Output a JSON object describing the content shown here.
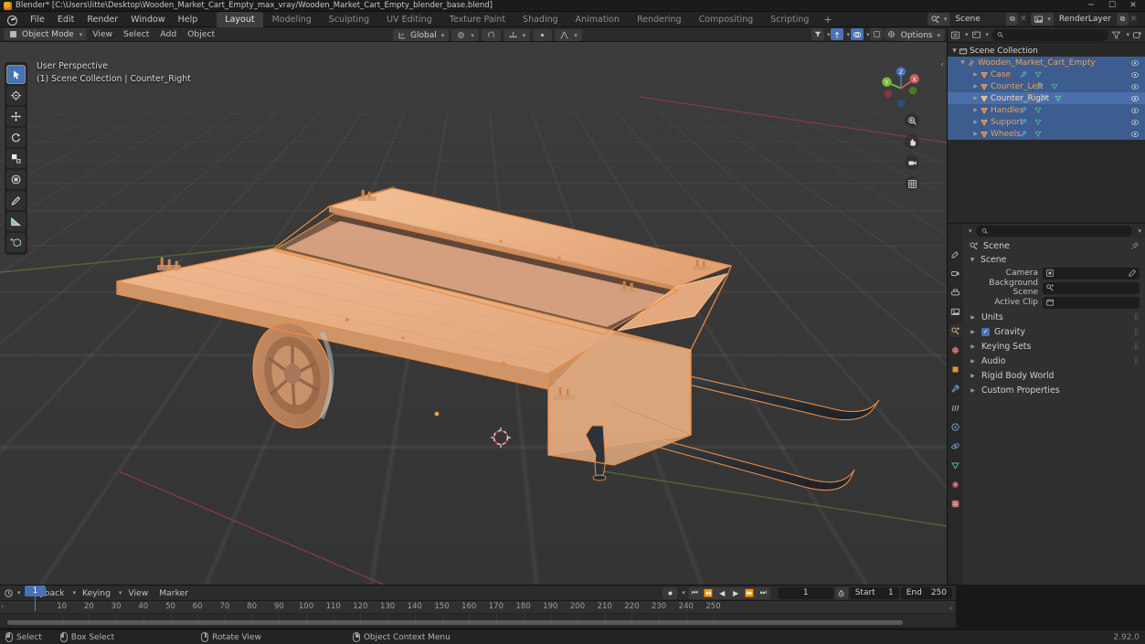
{
  "window": {
    "title": "Blender* [C:\\Users\\litte\\Desktop\\Wooden_Market_Cart_Empty_max_vray/Wooden_Market_Cart_Empty_blender_base.blend]",
    "app_icon": "blender-logo-icon",
    "minimize": "─",
    "maximize": "☐",
    "close": "✕"
  },
  "topbar": {
    "menus": [
      "File",
      "Edit",
      "Render",
      "Window",
      "Help"
    ],
    "workspaces": [
      {
        "label": "Layout",
        "active": true
      },
      {
        "label": "Modeling",
        "active": false
      },
      {
        "label": "Sculpting",
        "active": false
      },
      {
        "label": "UV Editing",
        "active": false
      },
      {
        "label": "Texture Paint",
        "active": false
      },
      {
        "label": "Shading",
        "active": false
      },
      {
        "label": "Animation",
        "active": false
      },
      {
        "label": "Rendering",
        "active": false
      },
      {
        "label": "Compositing",
        "active": false
      },
      {
        "label": "Scripting",
        "active": false
      }
    ],
    "add_workspace": "+",
    "scene_name": "Scene",
    "viewlayer_name": "RenderLayer",
    "new_copy": "⧉",
    "unlink": "✕"
  },
  "viewport_header": {
    "mode": "Object Mode",
    "menus": [
      "View",
      "Select",
      "Add",
      "Object"
    ],
    "transform_orientation": "Global",
    "options_label": "Options"
  },
  "viewport": {
    "perspective_label": "User Perspective",
    "collection_label": "(1) Scene Collection | Counter_Right",
    "gizmo_axes": [
      {
        "label": "Z",
        "color": "#4772b3"
      },
      {
        "label": "X",
        "color": "#cd5c5c"
      },
      {
        "label": "Y",
        "color": "#7dbd3a"
      }
    ],
    "nav_icons": [
      "zoom-icon",
      "hand-pan-icon",
      "camera-icon",
      "grid-ortho-icon"
    ],
    "tools": [
      {
        "name": "tweak-select-tool",
        "active": true
      },
      {
        "name": "cursor-tool",
        "active": false
      },
      {
        "name": "move-tool",
        "active": false
      },
      {
        "name": "rotate-tool",
        "active": false
      },
      {
        "name": "scale-tool",
        "active": false
      },
      {
        "name": "transform-tool",
        "active": false
      },
      {
        "name": "annotate-tool",
        "active": false
      },
      {
        "name": "measure-tool",
        "active": false
      },
      {
        "name": "add-cube-tool",
        "active": false
      }
    ],
    "model": {
      "name": "Wooden Market Cart",
      "wood_color": "#e8ab7c",
      "wood_light": "#f0bb92",
      "wood_shadow": "#c98e63",
      "handle_color": "#3a4047",
      "selection_outline": "#ed8b43",
      "active_outline": "#f8bc7d",
      "origin_dot": "#f0a04a"
    }
  },
  "outliner": {
    "title": "Scene Collection",
    "search_placeholder": "",
    "filter_icon": "funnel-icon",
    "display_mode_icon": "view-layer-icon",
    "new_collection_icon": "new-collection-icon",
    "items": [
      {
        "label": "Wooden_Market_Cart_Empty",
        "indent": 0,
        "state": "selected",
        "icon": "empty-axes-icon",
        "color": "#e8a25e"
      },
      {
        "label": "Case",
        "indent": 1,
        "state": "selected",
        "icon": "mesh-data-icon",
        "color": "#e8a25e"
      },
      {
        "label": "Counter_Left",
        "indent": 1,
        "state": "selected",
        "icon": "mesh-data-icon",
        "color": "#e8a25e"
      },
      {
        "label": "Counter_Right",
        "indent": 1,
        "state": "active",
        "icon": "mesh-data-icon",
        "color": "#ffd4a0"
      },
      {
        "label": "Handles",
        "indent": 1,
        "state": "selected",
        "icon": "mesh-data-icon",
        "color": "#e8a25e"
      },
      {
        "label": "Support",
        "indent": 1,
        "state": "selected",
        "icon": "mesh-data-icon",
        "color": "#e8a25e"
      },
      {
        "label": "Wheels",
        "indent": 1,
        "state": "selected",
        "icon": "mesh-data-icon",
        "color": "#e8a25e"
      }
    ]
  },
  "properties": {
    "search_placeholder": "",
    "breadcrumb": "Scene",
    "pin_icon": "pin-icon",
    "tabs": [
      {
        "name": "tool-tab",
        "glyph": "⚙",
        "active": false
      },
      {
        "name": "render-tab",
        "glyph": "📷",
        "active": false
      },
      {
        "name": "output-tab",
        "glyph": "🖨",
        "active": false
      },
      {
        "name": "view-layer-tab",
        "glyph": "🖼",
        "active": false
      },
      {
        "name": "scene-tab",
        "glyph": "◎",
        "active": true
      },
      {
        "name": "world-tab",
        "glyph": "●",
        "active": false
      },
      {
        "name": "object-tab",
        "glyph": "▣",
        "active": false
      },
      {
        "name": "modifier-tab",
        "glyph": "🔧",
        "active": false
      },
      {
        "name": "particles-tab",
        "glyph": "⁂",
        "active": false
      },
      {
        "name": "physics-tab",
        "glyph": "⦿",
        "active": false
      },
      {
        "name": "constraints-tab",
        "glyph": "⎈",
        "active": false
      },
      {
        "name": "object-data-tab",
        "glyph": "▽",
        "active": false
      },
      {
        "name": "material-tab",
        "glyph": "◉",
        "active": false
      },
      {
        "name": "texture-tab",
        "glyph": "▦",
        "active": false
      }
    ],
    "panel_title": "Scene",
    "fields": [
      {
        "label": "Camera",
        "value": "",
        "icon": "camera-icon",
        "extra_icon": "eyedropper-icon"
      },
      {
        "label": "Background Scene",
        "value": "",
        "icon": "scene-icon",
        "extra_icon": ""
      },
      {
        "label": "Active Clip",
        "value": "",
        "icon": "clapperboard-icon",
        "extra_icon": ""
      }
    ],
    "subpanels": [
      {
        "label": "Units",
        "checkbox": false
      },
      {
        "label": "Gravity",
        "checkbox": true
      },
      {
        "label": "Keying Sets",
        "checkbox": false
      },
      {
        "label": "Audio",
        "checkbox": false
      },
      {
        "label": "Rigid Body World",
        "checkbox": false
      },
      {
        "label": "Custom Properties",
        "checkbox": false
      }
    ]
  },
  "timeline": {
    "menus": [
      "Playback",
      "Keying",
      "View",
      "Marker"
    ],
    "editor_icon": "clock-icon",
    "record_icon": "record-icon",
    "playback_buttons": [
      "⏮",
      "⏪",
      "◀",
      "▶",
      "⏩",
      "⏭"
    ],
    "current_frame": "1",
    "start_label": "Start",
    "start_value": "1",
    "end_label": "End",
    "end_value": "250",
    "playhead_frame": "1",
    "ticks": [
      "10",
      "20",
      "30",
      "40",
      "50",
      "60",
      "70",
      "80",
      "90",
      "100",
      "110",
      "120",
      "130",
      "140",
      "150",
      "160",
      "170",
      "180",
      "190",
      "200",
      "210",
      "220",
      "230",
      "240",
      "250"
    ]
  },
  "statusbar": {
    "items": [
      {
        "label": "Select",
        "mouse": "left"
      },
      {
        "label": "Box Select",
        "mouse": "left-drag"
      },
      {
        "label": "Rotate View",
        "mouse": "middle"
      },
      {
        "label": "Object Context Menu",
        "mouse": "right"
      }
    ],
    "version": "2.92.0"
  }
}
